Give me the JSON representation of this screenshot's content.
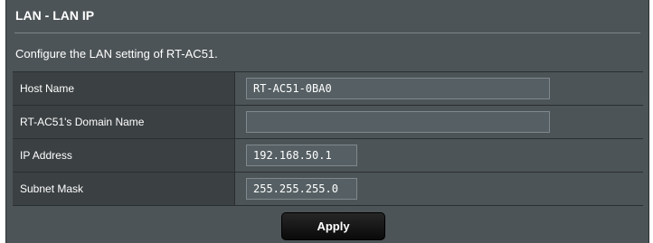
{
  "panel": {
    "title": "LAN - LAN IP",
    "description": "Configure the LAN setting of RT-AC51."
  },
  "fields": {
    "host_name": {
      "label": "Host Name",
      "value": "RT-AC51-0BA0"
    },
    "domain_name": {
      "label": "RT-AC51's Domain Name",
      "value": ""
    },
    "ip_address": {
      "label": "IP Address",
      "value": "192.168.50.1"
    },
    "subnet_mask": {
      "label": "Subnet Mask",
      "value": "255.255.255.0"
    }
  },
  "actions": {
    "apply_label": "Apply"
  },
  "colors": {
    "panel_bg": "#4d5457",
    "label_bg": "#3b4042",
    "input_bg": "#566064",
    "button_bg": "#111111"
  }
}
